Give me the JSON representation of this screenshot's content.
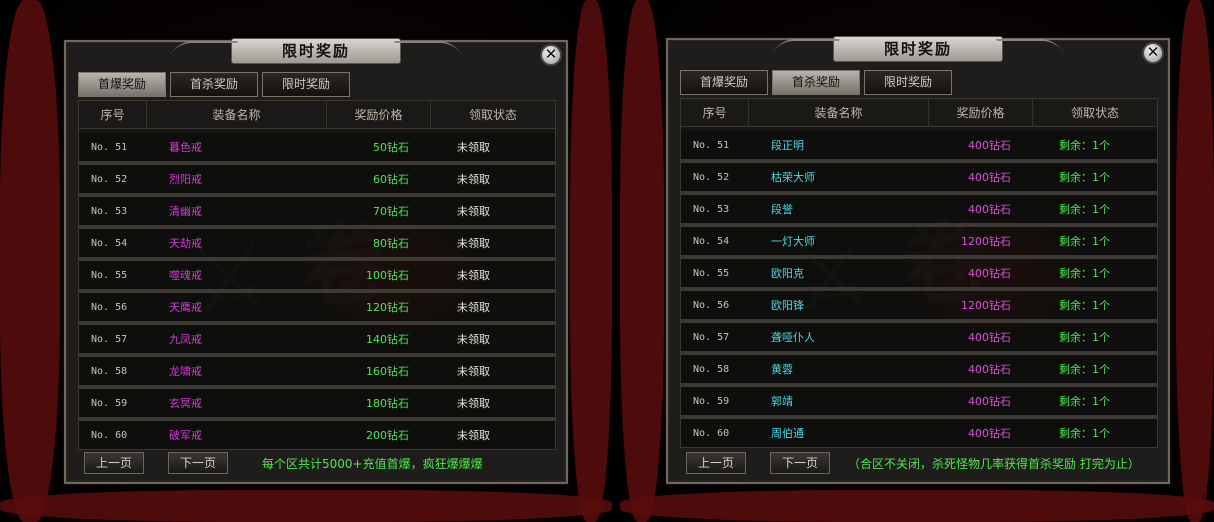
{
  "left_panel": {
    "title": "限时奖励",
    "close_label": "✕",
    "tabs": [
      {
        "label": "首爆奖励",
        "active": true
      },
      {
        "label": "首杀奖励",
        "active": false
      },
      {
        "label": "限时奖励",
        "active": false
      }
    ],
    "headers": {
      "no": "序号",
      "name": "装备名称",
      "price": "奖励价格",
      "status": "领取状态"
    },
    "rows": [
      {
        "no": "No. 51",
        "name": "暮色戒",
        "price": "50钻石",
        "status": "未领取"
      },
      {
        "no": "No. 52",
        "name": "烈阳戒",
        "price": "60钻石",
        "status": "未领取"
      },
      {
        "no": "No. 53",
        "name": "清幽戒",
        "price": "70钻石",
        "status": "未领取"
      },
      {
        "no": "No. 54",
        "name": "天劫戒",
        "price": "80钻石",
        "status": "未领取"
      },
      {
        "no": "No. 55",
        "name": "噬魂戒",
        "price": "100钻石",
        "status": "未领取"
      },
      {
        "no": "No. 56",
        "name": "天鹰戒",
        "price": "120钻石",
        "status": "未领取"
      },
      {
        "no": "No. 57",
        "name": "九凤戒",
        "price": "140钻石",
        "status": "未领取"
      },
      {
        "no": "No. 58",
        "name": "龙啸戒",
        "price": "160钻石",
        "status": "未领取"
      },
      {
        "no": "No. 59",
        "name": "玄冥戒",
        "price": "180钻石",
        "status": "未领取"
      },
      {
        "no": "No. 60",
        "name": "破军戒",
        "price": "200钻石",
        "status": "未领取"
      }
    ],
    "prev_label": "上一页",
    "next_label": "下一页",
    "note": "每个区共计5000+充值首爆，疯狂爆爆爆"
  },
  "right_panel": {
    "title": "限时奖励",
    "close_label": "✕",
    "tabs": [
      {
        "label": "首爆奖励",
        "active": false
      },
      {
        "label": "首杀奖励",
        "active": true
      },
      {
        "label": "限时奖励",
        "active": false
      }
    ],
    "headers": {
      "no": "序号",
      "name": "装备名称",
      "price": "奖励价格",
      "status": "领取状态"
    },
    "rows": [
      {
        "no": "No. 51",
        "name": "段正明",
        "price": "400钻石",
        "status": "剩余：1个"
      },
      {
        "no": "No. 52",
        "name": "枯荣大师",
        "price": "400钻石",
        "status": "剩余：1个"
      },
      {
        "no": "No. 53",
        "name": "段誉",
        "price": "400钻石",
        "status": "剩余：1个"
      },
      {
        "no": "No. 54",
        "name": "一灯大师",
        "price": "1200钻石",
        "status": "剩余：1个"
      },
      {
        "no": "No. 55",
        "name": "欧阳克",
        "price": "400钻石",
        "status": "剩余：1个"
      },
      {
        "no": "No. 56",
        "name": "欧阳锋",
        "price": "1200钻石",
        "status": "剩余：1个"
      },
      {
        "no": "No. 57",
        "name": "聋哑仆人",
        "price": "400钻石",
        "status": "剩余：1个"
      },
      {
        "no": "No. 58",
        "name": "黄蓉",
        "price": "400钻石",
        "status": "剩余：1个"
      },
      {
        "no": "No. 59",
        "name": "郭靖",
        "price": "400钻石",
        "status": "剩余：1个"
      },
      {
        "no": "No. 60",
        "name": "周伯通",
        "price": "400钻石",
        "status": "剩余：1个"
      }
    ],
    "prev_label": "上一页",
    "next_label": "下一页",
    "note": "（合区不关闭，杀死怪物几率获得首杀奖励 打完为止）"
  },
  "colors": {
    "name_purple": "#d23ad8",
    "name_cyan": "#4ed8e8",
    "price_green": "#4ee84e",
    "price_magenta": "#e04ee0",
    "status_green": "#4ee84e"
  }
}
